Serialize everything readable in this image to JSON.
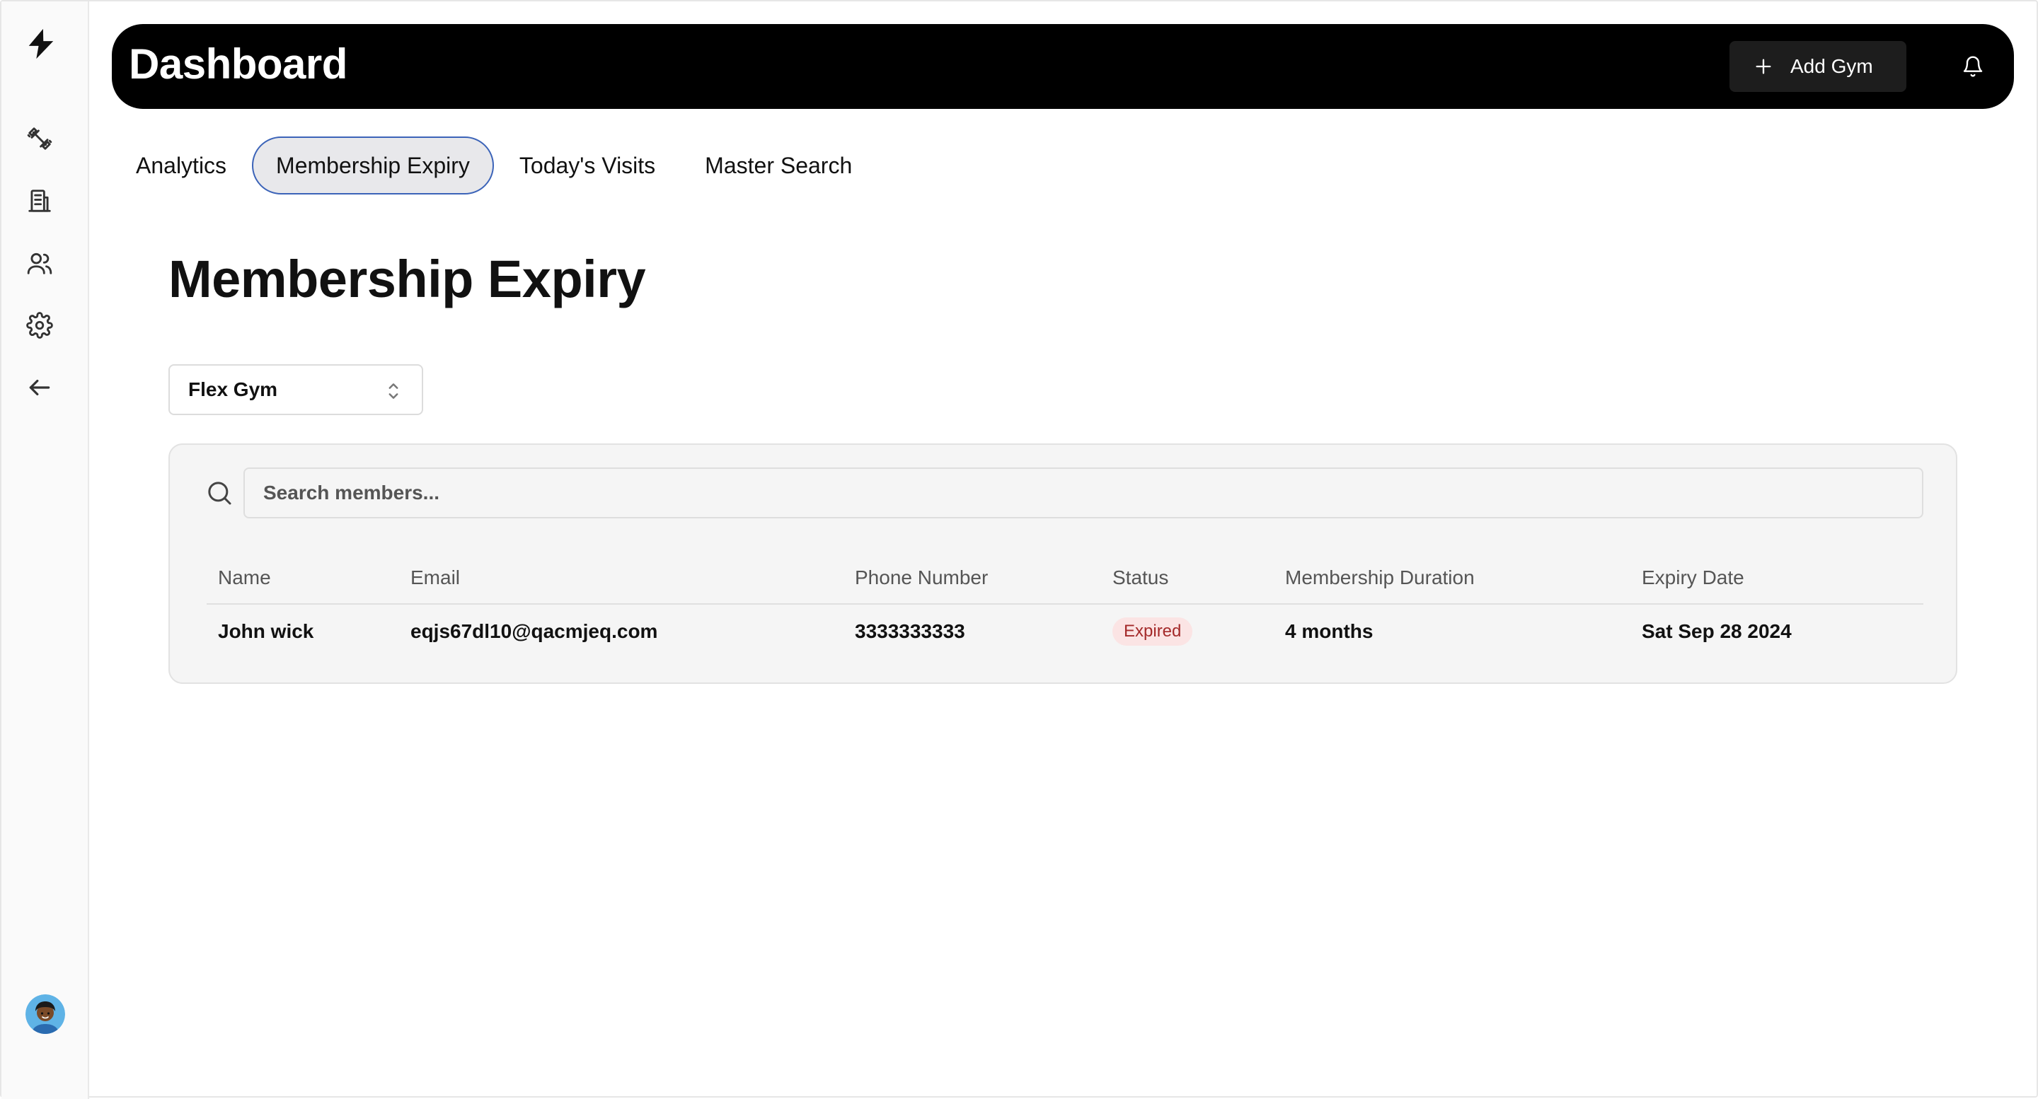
{
  "header": {
    "title": "Dashboard",
    "add_gym_label": "Add Gym"
  },
  "sidebar": {
    "icons": [
      "bolt-logo-icon",
      "dumbbell-icon",
      "building-icon",
      "users-icon",
      "gear-icon",
      "arrow-left-icon"
    ]
  },
  "tabs": [
    {
      "label": "Analytics",
      "active": false
    },
    {
      "label": "Membership Expiry",
      "active": true
    },
    {
      "label": "Today's Visits",
      "active": false
    },
    {
      "label": "Master Search",
      "active": false
    }
  ],
  "main": {
    "title": "Membership Expiry",
    "gym_select": {
      "value": "Flex Gym"
    },
    "search": {
      "placeholder": "Search members..."
    }
  },
  "table": {
    "columns": [
      "Name",
      "Email",
      "Phone Number",
      "Status",
      "Membership Duration",
      "Expiry Date"
    ],
    "rows": [
      {
        "name": "John wick",
        "email": "eqjs67dl10@qacmjeq.com",
        "phone": "3333333333",
        "status": "Expired",
        "duration": "4 months",
        "expiry": "Sat Sep 28 2024"
      }
    ]
  },
  "colors": {
    "header_bg": "#000000",
    "active_tab_border": "#3b63b8",
    "expired_badge_bg": "#fbe4e4",
    "expired_badge_text": "#a42a2a"
  }
}
